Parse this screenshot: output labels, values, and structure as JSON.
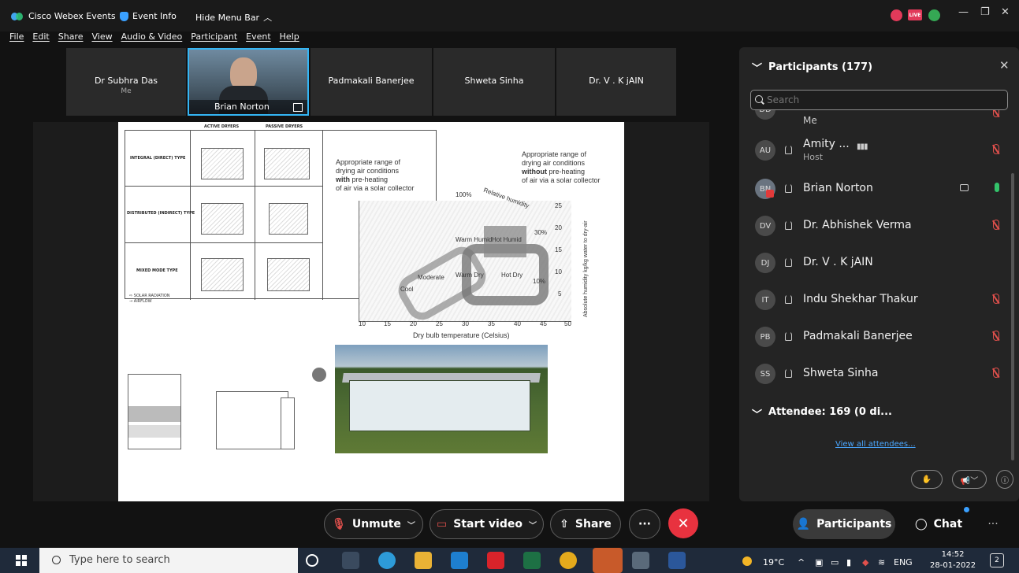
{
  "titlebar": {
    "app_name": "Cisco Webex Events",
    "event_info": "Event Info",
    "hide_menu": "Hide Menu Bar",
    "live_badge": "LIVE"
  },
  "menu": [
    "File",
    "Edit",
    "Share",
    "View",
    "Audio & Video",
    "Participant",
    "Event",
    "Help"
  ],
  "videos": [
    {
      "name": "Dr Subhra Das",
      "sub": "Me"
    },
    {
      "name": "Brian Norton",
      "sub": ""
    },
    {
      "name": "Padmakali Banerjee",
      "sub": ""
    },
    {
      "name": "Shweta Sinha",
      "sub": ""
    },
    {
      "name": "Dr. V . K jAIN",
      "sub": ""
    }
  ],
  "slide": {
    "col_headers": [
      "ACTIVE DRYERS",
      "PASSIVE DRYERS"
    ],
    "row_labels": [
      "INTEGRAL (DIRECT) TYPE",
      "DISTRIBUTED (INDIRECT) TYPE",
      "MIXED MODE TYPE"
    ],
    "legend": [
      "SOLAR RADIATION",
      "AIRFLOW"
    ],
    "note_with_1": "Appropriate range of",
    "note_with_2": "drying air conditions",
    "note_with_3_bold": "with",
    "note_with_3_rest": "pre-heating",
    "note_with_4": "of air via a solar collector",
    "note_without_1": "Appropriate range of",
    "note_without_2": "drying air conditions",
    "note_without_3_bold": "without",
    "note_without_3_rest": "pre-heating",
    "note_without_4": "of air via a solar collector",
    "rh_label": "Relative humidity",
    "rh_100": "100%",
    "rh_30": "30%",
    "rh_10": "10%",
    "zones": [
      "Warm Humid",
      "Hot Humid",
      "Moderate",
      "Warm Dry",
      "Hot Dry",
      "Cool"
    ],
    "x_ticks": [
      "10",
      "15",
      "20",
      "25",
      "30",
      "35",
      "40",
      "45",
      "50"
    ],
    "y_ticks": [
      "25",
      "20",
      "15",
      "10",
      "5"
    ],
    "x_label": "Dry bulb temperature (Celsius)",
    "y_label": "Absolute humidity kg/kg water to dry-air"
  },
  "panel": {
    "title": "Participants (177)",
    "search_placeholder": "Search",
    "participants": [
      {
        "initials": "DD",
        "name": "",
        "sub": "Me"
      },
      {
        "initials": "AU",
        "name": "Amity ...",
        "sub": "Host"
      },
      {
        "initials": "BN",
        "name": "Brian Norton",
        "sub": ""
      },
      {
        "initials": "DV",
        "name": "Dr. Abhishek Verma",
        "sub": ""
      },
      {
        "initials": "DJ",
        "name": "Dr. V . K jAIN",
        "sub": ""
      },
      {
        "initials": "IT",
        "name": "Indu Shekhar Thakur",
        "sub": ""
      },
      {
        "initials": "PB",
        "name": "Padmakali Banerjee",
        "sub": ""
      },
      {
        "initials": "SS",
        "name": "Shweta Sinha",
        "sub": ""
      }
    ],
    "attendee": "Attendee: 169 (0 di...",
    "view_all": "View all attendees..."
  },
  "controls": {
    "unmute": "Unmute",
    "start_video": "Start video",
    "share": "Share",
    "more": "···",
    "participants": "Participants",
    "chat": "Chat",
    "more_right": "···"
  },
  "taskbar": {
    "search_placeholder": "Type here to search",
    "temp": "19°C",
    "lang": "ENG",
    "time": "14:52",
    "date": "28-01-2022",
    "notif": "2"
  }
}
